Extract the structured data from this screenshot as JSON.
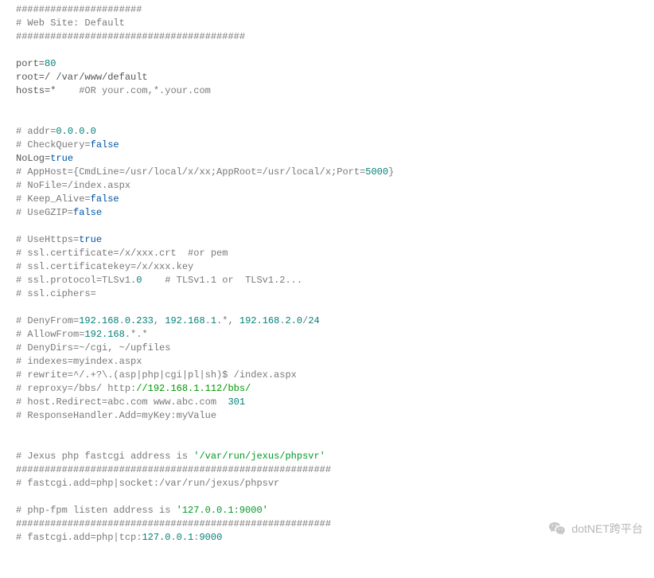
{
  "lines": {
    "l1": "######################",
    "l2": "# Web Site: Default",
    "l3": "########################################",
    "l5a": "port=",
    "l5b": "80",
    "l6": "root=/ /var/www/default",
    "l7a": "hosts=*    ",
    "l7b": "#OR your.com,*.your.com",
    "l10a": "# addr=",
    "l10b": "0.0",
    "l10c": ".",
    "l10d": "0.0",
    "l11a": "# CheckQuery=",
    "l11b": "false",
    "l12a": "NoLog=",
    "l12b": "true",
    "l13a": "# AppHost={CmdLine=/usr/local/x/xx;AppRoot=/usr/local/x;Port=",
    "l13b": "5000",
    "l13c": "}",
    "l14": "# NoFile=/index.aspx",
    "l15a": "# Keep_Alive=",
    "l15b": "false",
    "l16a": "# UseGZIP=",
    "l16b": "false",
    "l18a": "# UseHttps=",
    "l18b": "true",
    "l19a": "# ssl.certificate=/x/xxx.crt  ",
    "l19b": "#or pem",
    "l20": "# ssl.certificatekey=/x/xxx.key",
    "l21a": "# ssl.protocol=TLSv1.",
    "l21b": "0",
    "l21c": "    ",
    "l21d": "# TLSv1.1 or  TLSv1.2...",
    "l22": "# ssl.ciphers=",
    "l24a": "# DenyFrom=",
    "l24b": "192.168",
    "l24c": ".",
    "l24d": "0.233",
    "l24e": ", ",
    "l24f": "192.168",
    "l24g": ".",
    "l24h": "1",
    "l24i": ".*, ",
    "l24j": "192.168",
    "l24k": ".",
    "l24l": "2.0",
    "l24m": "/",
    "l24n": "24",
    "l25a": "# AllowFrom=",
    "l25b": "192.168",
    "l25c": ".*.*",
    "l26": "# DenyDirs=~/cgi, ~/upfiles",
    "l27": "# indexes=myindex.aspx",
    "l28": "# rewrite=^/.+?\\.(asp|php|cgi|pl|sh)$ /index.aspx",
    "l29a": "# reproxy=/bbs/ http:",
    "l29b": "//192.168.1.112/bbs/",
    "l30a": "# host.Redirect=abc.com www.abc.com  ",
    "l30b": "301",
    "l31": "# ResponseHandler.Add=myKey:myValue",
    "l34a": "# Jexus php fastcgi address is ",
    "l34b": "'/var/run/jexus/phpsvr'",
    "l35": "#######################################################",
    "l36": "# fastcgi.add=php|socket:/var/run/jexus/phpsvr",
    "l38a": "# php-fpm listen address is ",
    "l38b": "'127.0.0.1:9000'",
    "l39": "#######################################################",
    "l40a": "# fastcgi.add=php|tcp:",
    "l40b": "127.0",
    "l40c": ".",
    "l40d": "0.1",
    "l40e": ":",
    "l40f": "9000"
  },
  "watermark": "dotNET跨平台"
}
